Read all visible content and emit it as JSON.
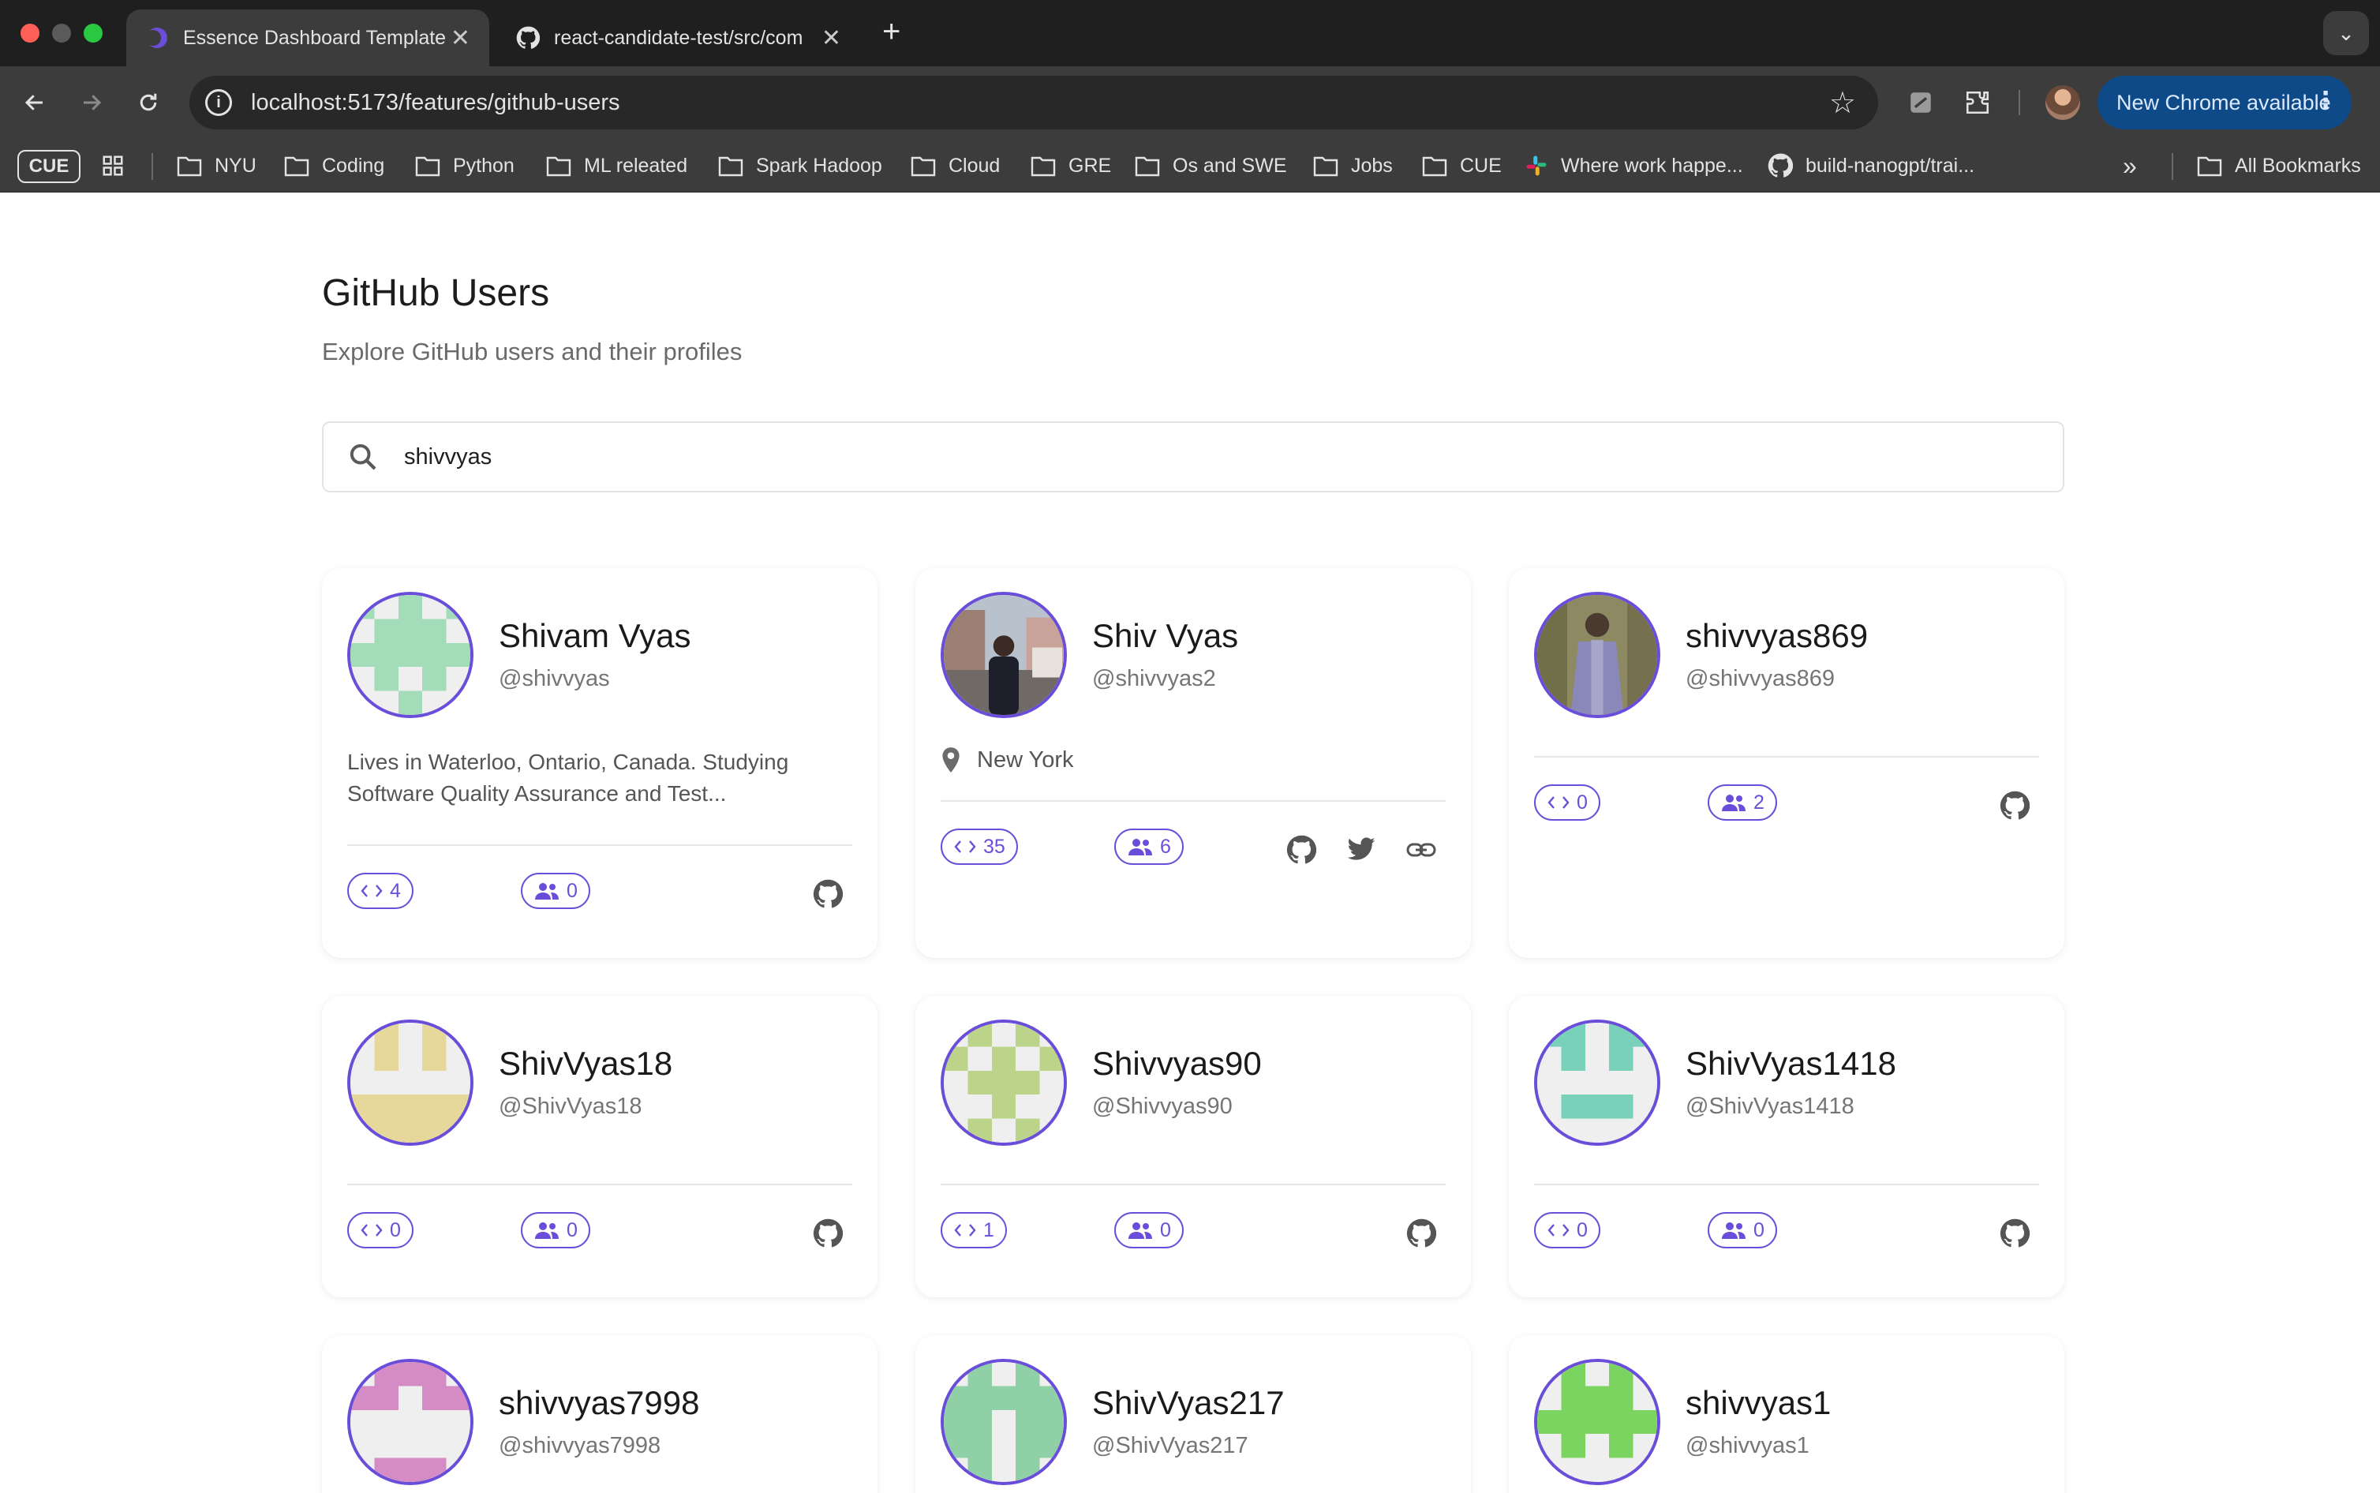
{
  "browser": {
    "tabs": [
      {
        "title": "Essence Dashboard Template",
        "active": true,
        "icon": "essence-logo-icon"
      },
      {
        "title": "react-candidate-test/src/com",
        "active": false,
        "icon": "github-icon"
      }
    ],
    "url": "localhost:5173/features/github-users",
    "update_button": "New Chrome available",
    "bookmarks": [
      {
        "label": "CUE",
        "kind": "chip"
      },
      {
        "label": "NYU",
        "kind": "folder"
      },
      {
        "label": "Coding",
        "kind": "folder"
      },
      {
        "label": "Python",
        "kind": "folder"
      },
      {
        "label": "ML releated",
        "kind": "folder"
      },
      {
        "label": "Spark Hadoop",
        "kind": "folder"
      },
      {
        "label": "Cloud",
        "kind": "folder"
      },
      {
        "label": "GRE",
        "kind": "folder"
      },
      {
        "label": "Os and SWE",
        "kind": "folder"
      },
      {
        "label": "Jobs",
        "kind": "folder"
      },
      {
        "label": "CUE",
        "kind": "folder"
      },
      {
        "label": "Where work happe...",
        "kind": "slack"
      },
      {
        "label": "build-nanogpt/trai...",
        "kind": "github"
      },
      {
        "label": "All Bookmarks",
        "kind": "folder"
      }
    ]
  },
  "page": {
    "title": "GitHub Users",
    "subtitle": "Explore GitHub users and their profiles",
    "search_value": "shivvyas"
  },
  "colors": {
    "accent": "#6a4ed9",
    "icon_gray": "#555555"
  },
  "users": [
    {
      "name": "Shivam Vyas",
      "login": "@shivvyas",
      "bio": "Lives in Waterloo, Ontario, Canada. Studying Software Quality Assurance and Test...",
      "repos": "4",
      "followers": "0",
      "links": [
        "github-icon"
      ],
      "avatar_color": "#a3dcb8"
    },
    {
      "name": "Shiv Vyas",
      "login": "@shivvyas2",
      "location": "New York",
      "repos": "35",
      "followers": "6",
      "links": [
        "github-icon",
        "twitter-icon",
        "link-icon"
      ],
      "avatar_color": "photo"
    },
    {
      "name": "shivvyas869",
      "login": "@shivvyas869",
      "repos": "0",
      "followers": "2",
      "links": [
        "github-icon"
      ],
      "avatar_color": "photo"
    },
    {
      "name": "ShivVyas18",
      "login": "@ShivVyas18",
      "repos": "0",
      "followers": "0",
      "links": [
        "github-icon"
      ],
      "avatar_color": "#e6d79a"
    },
    {
      "name": "Shivvyas90",
      "login": "@Shivvyas90",
      "repos": "1",
      "followers": "0",
      "links": [
        "github-icon"
      ],
      "avatar_color": "#bcd48a"
    },
    {
      "name": "ShivVyas1418",
      "login": "@ShivVyas1418",
      "repos": "0",
      "followers": "0",
      "links": [
        "github-icon"
      ],
      "avatar_color": "#79d1b9"
    },
    {
      "name": "shivvyas7998",
      "login": "@shivvyas7998",
      "avatar_color": "#d58cc4"
    },
    {
      "name": "ShivVyas217",
      "login": "@ShivVyas217",
      "avatar_color": "#8fd0a6"
    },
    {
      "name": "shivvyas1",
      "login": "@shivvyas1",
      "avatar_color": "#7bd45f"
    }
  ]
}
